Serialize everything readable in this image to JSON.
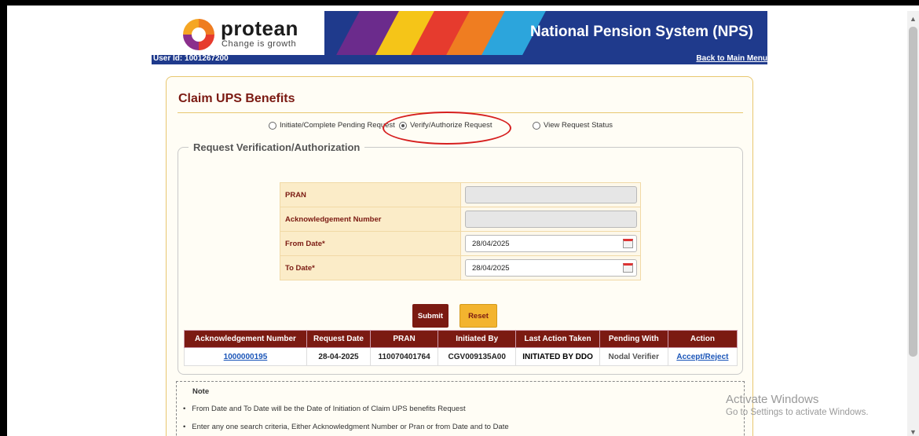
{
  "banner": {
    "logo_text": "protean",
    "logo_tagline": "Change is growth",
    "title": "National Pension System (NPS)",
    "stripe_colors": [
      "#6b2b8c",
      "#f5c518",
      "#e63b2e",
      "#ef7d21",
      "#2ca5dc"
    ]
  },
  "user_bar": {
    "user_id": "User Id: 1001267200",
    "back_link": "Back to Main Menu"
  },
  "card": {
    "title": "Claim UPS Benefits",
    "radios": [
      {
        "label": "Initiate/Complete Pending Request",
        "selected": false
      },
      {
        "label": "Verify/Authorize Request",
        "selected": true
      },
      {
        "label": "View Request Status",
        "selected": false
      }
    ],
    "section_legend": "Request Verification/Authorization"
  },
  "form": {
    "pran_label": "PRAN",
    "pran_value": "",
    "ack_label": "Acknowledgement Number",
    "ack_value": "",
    "from_label": "From Date*",
    "from_value": "28/04/2025",
    "to_label": "To Date*",
    "to_value": "28/04/2025",
    "submit_label": "Submit",
    "reset_label": "Reset"
  },
  "results": {
    "headers": [
      "Acknowledgement Number",
      "Request Date",
      "PRAN",
      "Initiated By",
      "Last Action Taken",
      "Pending With",
      "Action"
    ],
    "rows": [
      [
        "1000000195",
        "28-04-2025",
        "110070401764",
        "CGV009135A00",
        "INITIATED BY DDO",
        "Nodal Verifier",
        "Accept/Reject"
      ]
    ]
  },
  "note": {
    "title": "Note",
    "items": [
      "From Date and To Date will be the Date of Initiation of Claim UPS benefits Request",
      "Enter any one search criteria, Either Acknowledgment Number or Pran or from Date and to Date"
    ]
  },
  "watermark": {
    "line1": "Activate Windows",
    "line2": "Go to Settings to activate Windows."
  },
  "colors": {
    "banner_blue": "#1f3a8c",
    "maroon": "#7b1a12",
    "gold": "#f3b42f",
    "highlight_red": "#d61f1f"
  }
}
